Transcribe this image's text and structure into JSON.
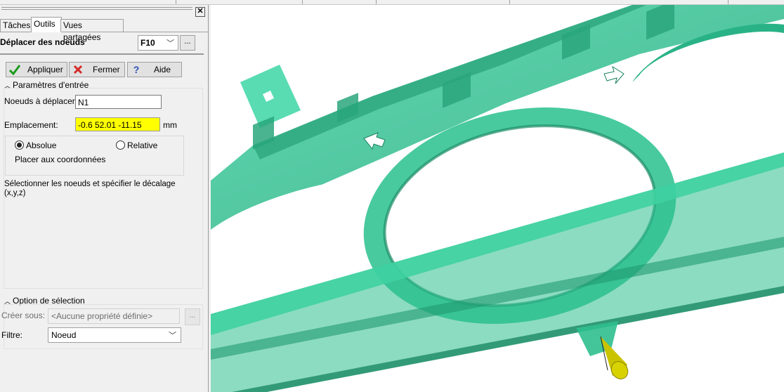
{
  "tabs": [
    {
      "label": "Tâches"
    },
    {
      "label": "Outils"
    },
    {
      "label": "Vues partagées"
    }
  ],
  "command": {
    "name": "Déplacer des noeuds",
    "shortcut": "F10",
    "more_label": "..."
  },
  "buttons": {
    "apply": "Appliquer",
    "close": "Fermer",
    "help": "Aide"
  },
  "input_params": {
    "title": "Paramètres d'entrée",
    "nodes_label": "Noeuds à déplacer:",
    "nodes_value": "N1",
    "location_label": "Emplacement:",
    "location_value": "-0.6 52.01 -11.15",
    "unit": "mm",
    "absolute_label": "Absolue",
    "relative_label": "Relative",
    "mode_selected": "Absolue",
    "placer_label": "Placer aux coordonnées",
    "hint": "Sélectionner les noeuds et spécifier le décalage",
    "hint2": "(x,y,z)"
  },
  "selection": {
    "title": "Option de sélection",
    "create_label": "Créer sous:",
    "create_value": "<Aucune propriété définie>",
    "create_btn": "...",
    "filter_label": "Filtre:",
    "filter_value": "Noeud"
  },
  "colors": {
    "model": "#2ec08f",
    "model_dark": "#1f8f69",
    "highlight": "#ffff00",
    "cone": "#c9c300"
  },
  "icons": {
    "apply": "check-icon",
    "close": "x-icon",
    "help": "question-icon"
  }
}
